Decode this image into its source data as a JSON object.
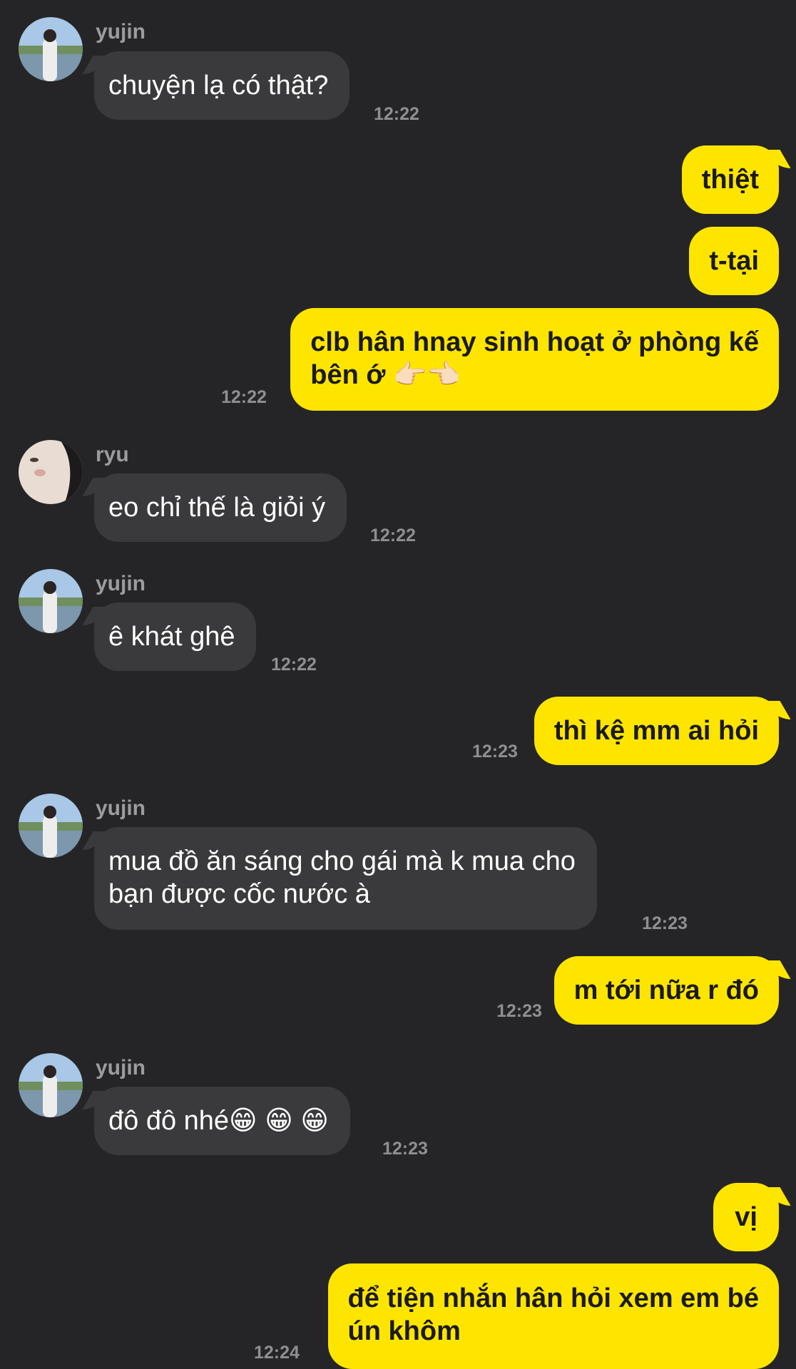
{
  "messages": [
    {
      "sender": "yujin",
      "text": "chuyện lạ có thật?",
      "time": "12:22"
    },
    {
      "text": "thiệt"
    },
    {
      "text": "t-tại"
    },
    {
      "text_line1": "clb hân hnay sinh hoạt ở phòng kế",
      "text_line2": "bên ớ 👉🏻👈🏻",
      "time": "12:22"
    },
    {
      "sender": "ryu",
      "text": "eo chỉ thế là giỏi ý",
      "time": "12:22"
    },
    {
      "sender": "yujin",
      "text": "ê khát ghê",
      "time": "12:22"
    },
    {
      "text": "thì kệ mm ai hỏi",
      "time": "12:23"
    },
    {
      "sender": "yujin",
      "text_line1": "mua đồ ăn sáng cho gái mà k mua cho",
      "text_line2": "bạn được cốc nước à",
      "time": "12:23"
    },
    {
      "text": "m tới nữa r đó",
      "time": "12:23"
    },
    {
      "sender": "yujin",
      "text": "đô đô nhé😁 😁 😁",
      "time": "12:23"
    },
    {
      "text": "vị"
    },
    {
      "text_line1": "để tiện nhắn hân hỏi xem em bé",
      "text_line2": "ún khôm",
      "time": "12:24"
    }
  ],
  "colors": {
    "background": "#252527",
    "incoming_bubble": "#3a3a3c",
    "outgoing_bubble": "#fee500"
  }
}
